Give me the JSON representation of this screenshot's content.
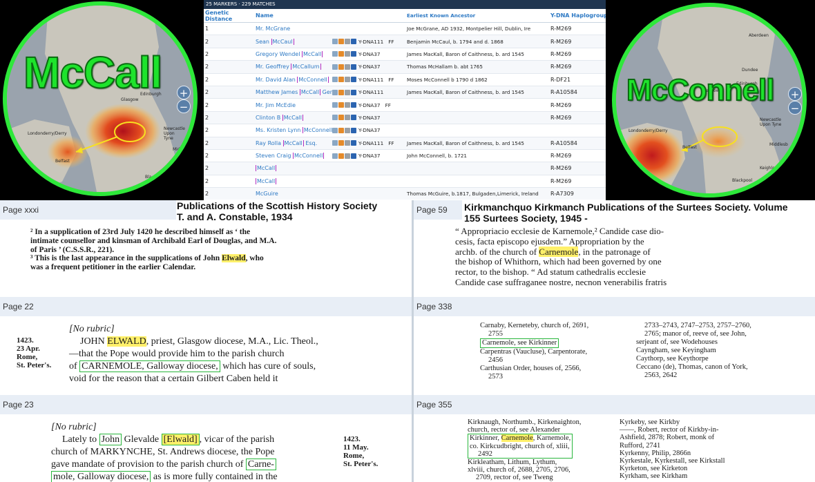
{
  "left_map": {
    "name": "McCall",
    "places": [
      "Glasgow",
      "Edinburgh",
      "Newcastle Upon Tyne",
      "Londonderry/Derry",
      "Belfast",
      "Middlesb",
      "Blackpool"
    ]
  },
  "right_map": {
    "name": "McConnell",
    "places": [
      "Aberdeen",
      "Dundee",
      "Glasgow",
      "Edinburgh",
      "Newcastle Upon Tyne",
      "Londonderry/Derry",
      "Belfast",
      "Middlesb",
      "Keighley",
      "Blackpool"
    ]
  },
  "zoom": {
    "plus": "+",
    "minus": "−"
  },
  "dna_table": {
    "topbar": "25 MARKERS · 229 MATCHES",
    "headers": [
      "Genetic Distance",
      "Name",
      "",
      "Earliest Known Ancestor",
      "Y-DNA Haplogroup"
    ],
    "rows": [
      {
        "gd": "1",
        "name_pre": "Mr. McGrane",
        "name_box": "",
        "name_post": "",
        "test": "",
        "ff": "",
        "ancestor": "Joe McGrane, AD 1932, Montpelier Hill, Dublin, Ire",
        "hap": "R-M269",
        "icons": false
      },
      {
        "gd": "2",
        "name_pre": "Sean ",
        "name_box": "McCaul",
        "name_post": "",
        "test": "Y-DNA111",
        "ff": "FF",
        "ancestor": "Benjamin McCaul, b. 1794 and d. 1868",
        "hap": "R-M269",
        "icons": true
      },
      {
        "gd": "2",
        "name_pre": "Gregory Wendel ",
        "name_box": "McCall",
        "name_post": "",
        "test": "Y-DNA37",
        "ff": "",
        "ancestor": "James MacKall, Baron of Caithness, b. ard 1545",
        "hap": "R-M269",
        "icons": true
      },
      {
        "gd": "2",
        "name_pre": "Mr. Geoffrey ",
        "name_box": "McCallum",
        "name_post": "",
        "test": "Y-DNA37",
        "ff": "",
        "ancestor": "Thomas McHallam b. abt 1765",
        "hap": "R-M269",
        "icons": true
      },
      {
        "gd": "2",
        "name_pre": "Mr. David Alan ",
        "name_box": "McConnell",
        "name_post": "",
        "test": "Y-DNA111",
        "ff": "FF",
        "ancestor": "Moses McConnell b 1790 d 1862",
        "hap": "R-DF21",
        "icons": true
      },
      {
        "gd": "2",
        "name_pre": "Matthew James ",
        "name_box": "McCall",
        "name_post": " Gent",
        "test": "Y-DNA111",
        "ff": "",
        "ancestor": "James MacKall, Baron of Caithness, b. ard 1545",
        "hap": "R-A10584",
        "icons": true
      },
      {
        "gd": "2",
        "name_pre": "Mr. Jim McEdie",
        "name_box": "",
        "name_post": "",
        "test": "Y-DNA37",
        "ff": "FF",
        "ancestor": "",
        "hap": "R-M269",
        "icons": true
      },
      {
        "gd": "2",
        "name_pre": "Clinton B ",
        "name_box": "McCall",
        "name_post": "",
        "test": "Y-DNA37",
        "ff": "",
        "ancestor": "",
        "hap": "R-M269",
        "icons": true
      },
      {
        "gd": "2",
        "name_pre": "Ms. Kristen Lynn ",
        "name_box": "McConnell",
        "name_post": "",
        "test": "Y-DNA37",
        "ff": "",
        "ancestor": "",
        "hap": "",
        "icons": true
      },
      {
        "gd": "2",
        "name_pre": "Ray Rolla ",
        "name_box": "McCall",
        "name_post": " Esq.",
        "test": "Y-DNA111",
        "ff": "FF",
        "ancestor": "James MacKall, Baron of Caithness, b. ard 1545",
        "hap": "R-A10584",
        "icons": true
      },
      {
        "gd": "2",
        "name_pre": "Steven Craig ",
        "name_box": "McConnell",
        "name_post": "",
        "test": "Y-DNA37",
        "ff": "",
        "ancestor": "John McConnell, b. 1721",
        "hap": "R-M269",
        "icons": true
      },
      {
        "gd": "2",
        "name_pre": "",
        "name_box": "McCall",
        "name_post": "",
        "test": "",
        "ff": "",
        "ancestor": "",
        "hap": "R-M269",
        "icons": false
      },
      {
        "gd": "2",
        "name_pre": "",
        "name_box": "McCall",
        "name_post": "",
        "test": "",
        "ff": "",
        "ancestor": "",
        "hap": "R-M269",
        "icons": false
      },
      {
        "gd": "2",
        "name_pre": "McGuire",
        "name_box": "",
        "name_post": "",
        "test": "",
        "ff": "",
        "ancestor": "Thomas McGuire, b.1817, Bulgaden,Limerick, Ireland",
        "hap": "R-A7309",
        "icons": false
      }
    ]
  },
  "panels": {
    "p1": {
      "page": "Page xxxi",
      "title1": "Publications of the Scottish History Society",
      "title2": "T. and A. Constable, 1934",
      "lines": [
        {
          "a": "² In a supplication of 23rd July 1420 he described himself as ‘ the",
          "b": "",
          "c": ""
        },
        {
          "a": "intimate counsellor and kinsman of Archibald Earl of Douglas, and M.A.",
          "b": "",
          "c": ""
        },
        {
          "a": "of Paris ’ (C.S.S.R., 221).",
          "b": "",
          "c": ""
        },
        {
          "a": "³ This is the last appearance in the supplications of John ",
          "b": "Elwald",
          "c": ", who"
        },
        {
          "a": "was a frequent petitioner in the earlier Calendar.",
          "b": "",
          "c": ""
        }
      ]
    },
    "p2": {
      "page": "Page 59",
      "title1": "Kirkmanchquo Kirkmanch Publications of the Surtees Society. Volume",
      "title2": "155   Surtees Society, 1945 -",
      "lines": [
        {
          "a": "“ Appropriacio ecclesie de Karnemole,² Candide case dio-",
          "b": "",
          "c": ""
        },
        {
          "a": "cesis, facta episcopo ejusdem.”  Appropriation by the",
          "b": "",
          "c": ""
        },
        {
          "a": "archb. of the church of ",
          "b": "Carnemole",
          "c": ", in the patronage of"
        },
        {
          "a": "the bishop of Whithorn, which had been governed by one",
          "b": "",
          "c": ""
        },
        {
          "a": "rector, to the bishop.  “ Ad statum cathedralis ecclesie",
          "b": "",
          "c": ""
        },
        {
          "a": "Candide case suffraganee nostre, necnon venerabilis fratris",
          "b": "",
          "c": ""
        }
      ]
    },
    "p3": {
      "page": "Page 22",
      "margin": [
        "1423.",
        "23 Apr.",
        "Rome,",
        "St. Peter's."
      ],
      "l1": "[No rubric]",
      "l2a": "JOHN ",
      "l2b": "ELWALD",
      "l2c": ", priest, Glasgow diocese, M.A., Lic. Theol.,",
      "l3": "—that the Pope would provide him to the parish church",
      "l4a": "of ",
      "l4b": "CARNEMOLE, Galloway diocese,",
      "l4c": " which has cure of souls,",
      "l5": "void for the reason that a certain Gilbert Caben held it"
    },
    "p4": {
      "page": "Page 338",
      "left": [
        "Carnaby, Kerneteby, church of, 2691,",
        "2755",
        "Carnemole, see Kirkinner",
        "Carpentras (Vaucluse), Carpentorate,",
        "2456",
        "Carthusian Order, houses of, 2566,",
        "2573"
      ],
      "right": [
        "2733–2743, 2747–2753, 2757–2760,",
        "2765; manor of, reeve of, see John,",
        "serjeant of, see Wodehouses",
        "Cayngham, see Keyingham",
        "Caythorp, see Keythorpe",
        "Ceccano (de), Thomas, canon of York,",
        "2563, 2642"
      ]
    },
    "p5": {
      "page": "Page 23",
      "margin": [
        "1423.",
        "11 May.",
        "Rome,",
        "St. Peter's."
      ],
      "l1": "[No rubric]",
      "l2a": "Lately to ",
      "l2b": "John",
      "l2c": " Glevalde ",
      "l2d": "[Elwald]",
      "l2e": ", vicar of the parish",
      "l3": "church of MARKYNCHE, St. Andrews diocese, the Pope",
      "l4a": "gave mandate of provision to the parish church of ",
      "l4b": "Carne-",
      "l5a": "mole, Galloway diocese,",
      "l5b": " as is more fully contained in the"
    },
    "p6": {
      "page": "Page 355",
      "left": [
        "Kirknaugh, Northumb., Kirkenaighton,",
        "church, rector of, see Alexander",
        "Kirkinner, Carnemole, Karnemole,",
        "co. Kirkcudbright, church of, xliii,",
        "2492",
        "Kirkleatham, Lithum, Lythum,",
        "xlviii, church of, 2688, 2705, 2706,",
        "2709, rector of, see Tweng"
      ],
      "right": [
        "Kyrkeby, see Kirkby",
        "——, Robert, rector of Kirkby-in-",
        "Ashfield, 2878; Robert, monk of",
        "Rufford, 2741",
        "Kyrkenny, Philip, 2866n",
        "Kyrkestale, Kyrkestall, see Kirkstall",
        "Kyrketon, see Kirketon",
        "Kyrkham, see Kirkham"
      ]
    }
  }
}
